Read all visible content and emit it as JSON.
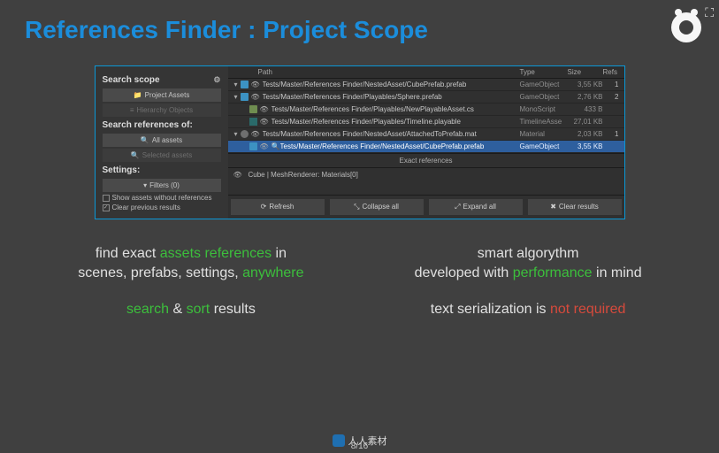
{
  "title": "References Finder : Project Scope",
  "page_indicator": "8/16",
  "watermark_text": "人人素材",
  "sidebar": {
    "scope_heading": "Search scope",
    "btn_project_assets": "Project Assets",
    "btn_hierarchy": "Hierarchy Objects",
    "refs_heading": "Search references of:",
    "btn_all_assets": "All assets",
    "btn_selected_assets": "Selected assets",
    "settings_heading": "Settings:",
    "btn_filters": "Filters (0)",
    "chk_show_without": "Show assets without references",
    "chk_clear_prev": "Clear previous results"
  },
  "table": {
    "headers": {
      "path": "Path",
      "type": "Type",
      "size": "Size",
      "refs": "Refs"
    },
    "rows": [
      {
        "kind": "cube",
        "path": "Tests/Master/References Finder/NestedAsset/CubePrefab.prefab",
        "type": "GameObject",
        "size": "3,55 KB",
        "refs": "1",
        "child": false
      },
      {
        "kind": "cube",
        "path": "Tests/Master/References Finder/Playables/Sphere.prefab",
        "type": "GameObject",
        "size": "2,76 KB",
        "refs": "2",
        "child": false
      },
      {
        "kind": "doc",
        "path": "Tests/Master/References Finder/Playables/NewPlayableAsset.cs",
        "type": "MonoScript",
        "size": "433 B",
        "refs": "",
        "child": true
      },
      {
        "kind": "tl",
        "path": "Tests/Master/References Finder/Playables/Timeline.playable",
        "type": "TimelineAsse",
        "size": "27,01 KB",
        "refs": "",
        "child": true
      },
      {
        "kind": "mat",
        "path": "Tests/Master/References Finder/NestedAsset/AttachedToPrefab.mat",
        "type": "Material",
        "size": "2,03 KB",
        "refs": "1",
        "child": false
      },
      {
        "kind": "cube",
        "path": "Tests/Master/References Finder/NestedAsset/CubePrefab.prefab",
        "type": "GameObject",
        "size": "3,55 KB",
        "refs": "",
        "child": true,
        "sel": true,
        "search": true
      }
    ],
    "exact_label": "Exact references",
    "detail": "Cube | MeshRenderer: Materials[0]"
  },
  "bottom": {
    "refresh": "Refresh",
    "collapse": "Collapse all",
    "expand": "Expand all",
    "clear": "Clear results"
  },
  "promo": {
    "l1a": "find exact ",
    "l1b": "assets references",
    "l1c": " in",
    "l2a": "scenes, prefabs, settings, ",
    "l2b": "anywhere",
    "l3a": "search",
    "l3amp": " & ",
    "l3b": "sort",
    "l3c": " results",
    "r1a": "smart algorythm",
    "r2a": "developed with ",
    "r2b": "performance",
    "r2c": " in mind",
    "r3a": "text serialization is ",
    "r3b": "not required"
  }
}
